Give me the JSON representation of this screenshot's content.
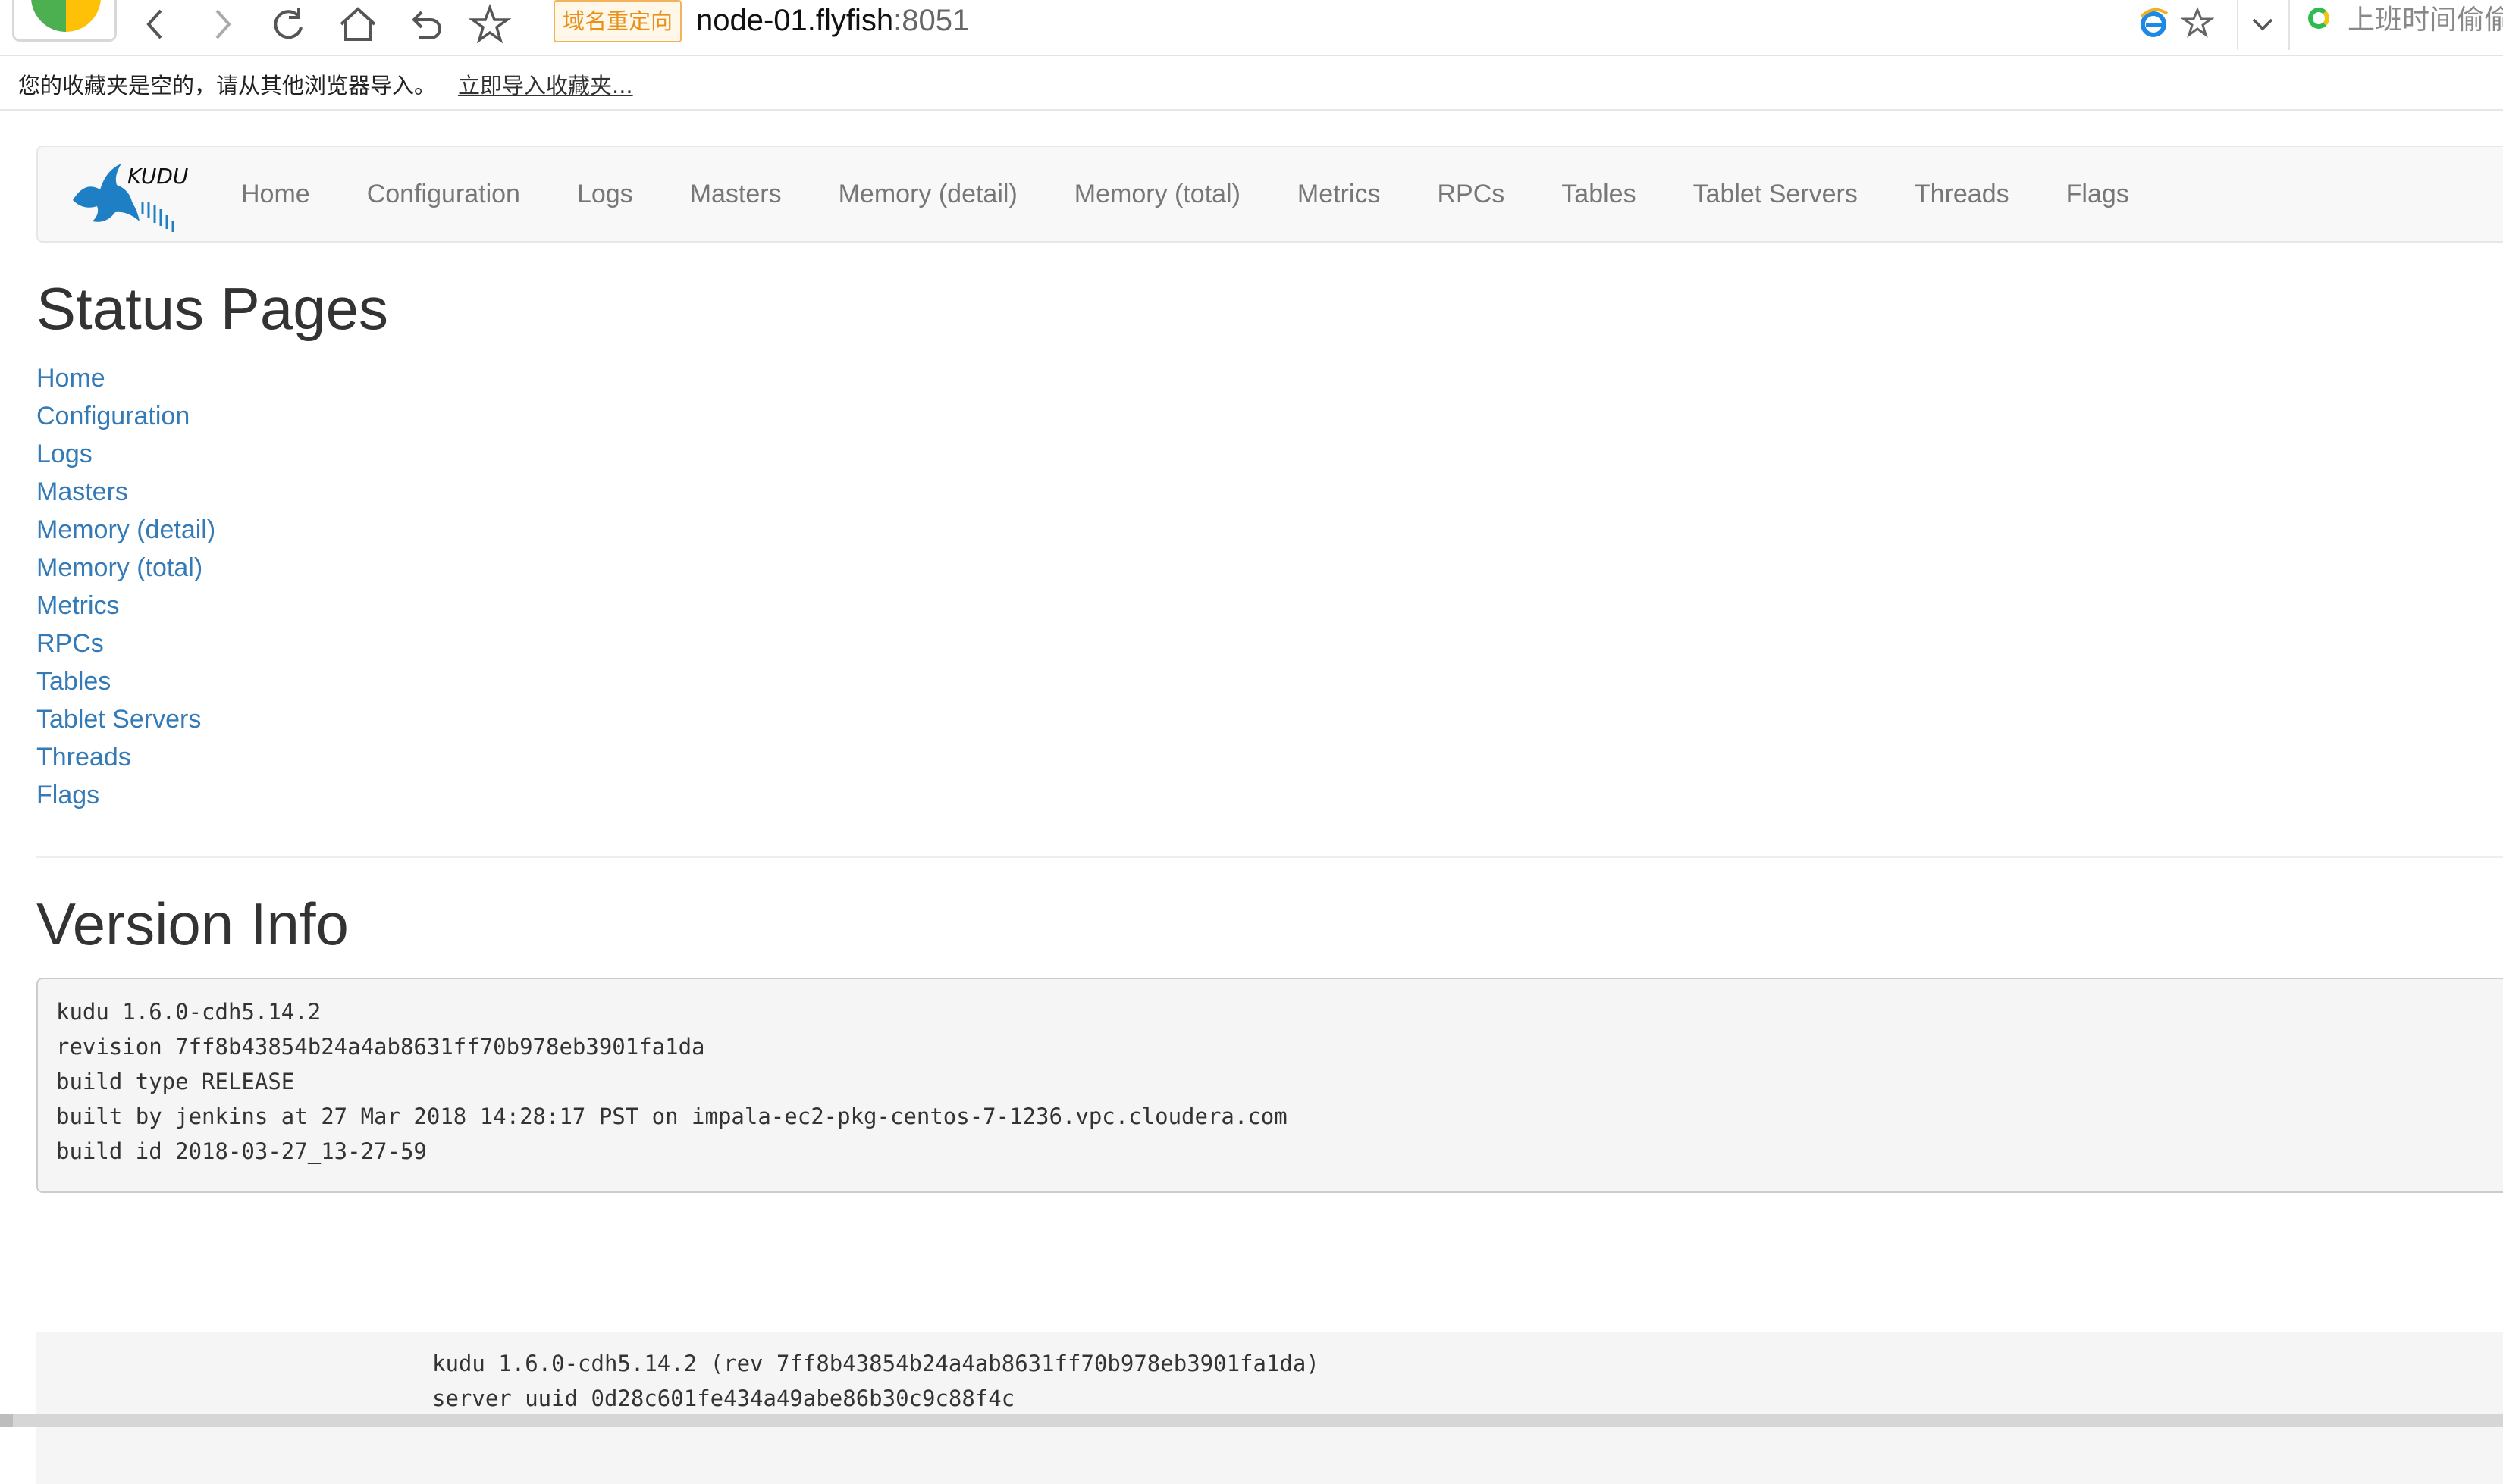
{
  "browser": {
    "redirect_badge": "域名重定向",
    "address_host": "node-01.flyfish",
    "address_port": ":8051",
    "news_text": "上班时间偷偷"
  },
  "bookmarks": {
    "message": "您的收藏夹是空的，请从其他浏览器导入。",
    "import_link": "立即导入收藏夹..."
  },
  "navbar": {
    "brand": "KUDU",
    "links": [
      "Home",
      "Configuration",
      "Logs",
      "Masters",
      "Memory (detail)",
      "Memory (total)",
      "Metrics",
      "RPCs",
      "Tables",
      "Tablet Servers",
      "Threads",
      "Flags"
    ]
  },
  "status": {
    "title": "Status Pages",
    "links": [
      "Home",
      "Configuration",
      "Logs",
      "Masters",
      "Memory (detail)",
      "Memory (total)",
      "Metrics",
      "RPCs",
      "Tables",
      "Tablet Servers",
      "Threads",
      "Flags"
    ]
  },
  "version": {
    "title": "Version Info",
    "lines": [
      "kudu 1.6.0-cdh5.14.2",
      "revision 7ff8b43854b24a4ab8631ff70b978eb3901fa1da",
      "build type RELEASE",
      "built by jenkins at 27 Mar 2018 14:28:17 PST on impala-ec2-pkg-centos-7-1236.vpc.cloudera.com",
      "build id 2018-03-27_13-27-59"
    ]
  },
  "footer": {
    "lines": [
      "kudu 1.6.0-cdh5.14.2 (rev 7ff8b43854b24a4ab8631ff70b978eb3901fa1da)",
      "server uuid 0d28c601fe434a49abe86b30c9c88f4c"
    ]
  }
}
